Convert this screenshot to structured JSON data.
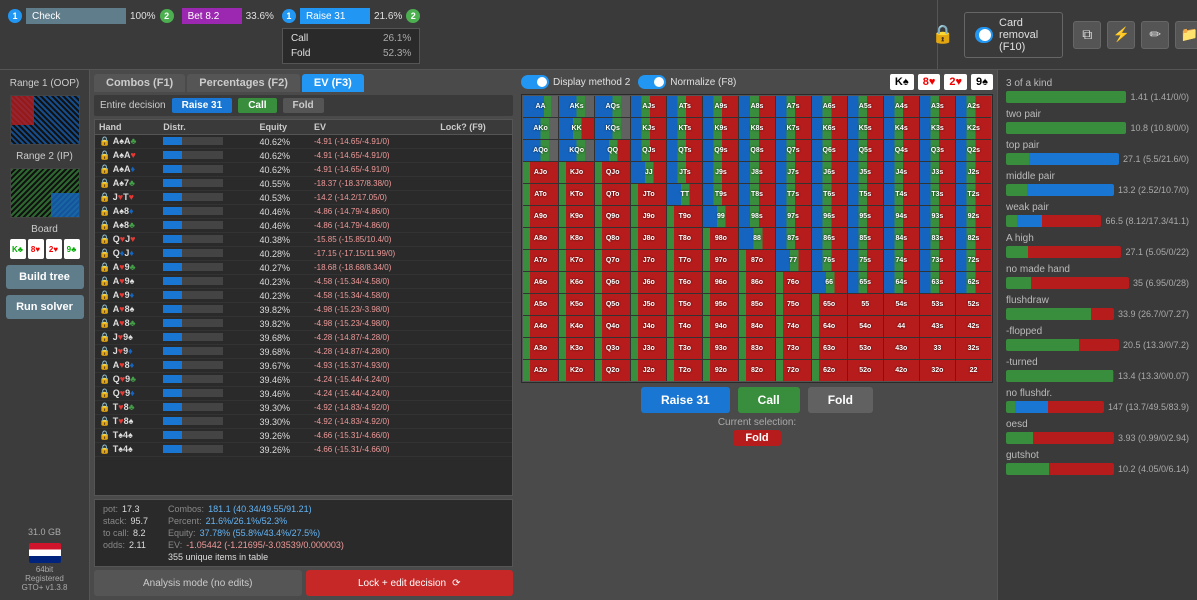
{
  "header": {
    "actions": [
      {
        "label": "Check",
        "pct": "100%",
        "type": "check",
        "badge": "1"
      },
      {
        "label": "Bet 8.2",
        "pct": "33.6%",
        "type": "bet",
        "badge": "2"
      },
      {
        "label": "Raise 31",
        "pct": "21.6%",
        "type": "raise",
        "badge": "1"
      },
      {
        "label": "Call",
        "pct": "26.1%",
        "type": "call"
      },
      {
        "label": "Fold",
        "pct": "52.3%",
        "type": "fold"
      }
    ],
    "card_removal": "Card removal (F10)",
    "badge2": "2"
  },
  "sidebar": {
    "range1_label": "Range 1 (OOP)",
    "range2_label": "Range 2 (IP)",
    "board_label": "Board",
    "board_cards": [
      "K♣",
      "8♥",
      "2♥",
      "9♣"
    ],
    "build_tree": "Build tree",
    "run_solver": "Run solver",
    "memory": "31.0 GB",
    "version": "64bit\nRegistered\nGTO+ v1.3.8"
  },
  "center": {
    "tabs": [
      "Combos (F1)",
      "Percentages (F2)",
      "EV (F3)"
    ],
    "active_tab": "EV (F3)",
    "toolbar": {
      "entire_decision": "Entire decision",
      "raise_label": "Raise 31",
      "call_label": "Call",
      "fold_label": "Fold"
    },
    "table_headers": [
      "Hand",
      "Distr.",
      "Equity",
      "EV",
      "Lock? (F9)"
    ],
    "hands": [
      {
        "hand": "A♠A♣",
        "distr": "",
        "equity": "40.62%",
        "ev": "-4.91 (-14.65/-4.91/0)"
      },
      {
        "hand": "A♠A♥",
        "distr": "",
        "equity": "40.62%",
        "ev": "-4.91 (-14.65/-4.91/0)"
      },
      {
        "hand": "A♠A♦",
        "distr": "",
        "equity": "40.62%",
        "ev": "-4.91 (-14.65/-4.91/0)"
      },
      {
        "hand": "A♠7♣",
        "distr": "",
        "equity": "40.55%",
        "ev": "-18.37 (-18.37/8.38/0)"
      },
      {
        "hand": "J♥T♥",
        "distr": "",
        "equity": "40.53%",
        "ev": "-14.2 (-14.2/17.05/0)"
      },
      {
        "hand": "A♠8♦",
        "distr": "",
        "equity": "40.46%",
        "ev": "-4.86 (-14.79/-4.86/0)"
      },
      {
        "hand": "A♠8♣",
        "distr": "",
        "equity": "40.46%",
        "ev": "-4.86 (-14.79/-4.86/0)"
      },
      {
        "hand": "Q♥J♥",
        "distr": "",
        "equity": "40.38%",
        "ev": "-15.85 (-15.85/10.4/0)"
      },
      {
        "hand": "Q♦J♦",
        "distr": "",
        "equity": "40.28%",
        "ev": "-17.15 (-17.15/11.99/0)"
      },
      {
        "hand": "A♥9♣",
        "distr": "",
        "equity": "40.27%",
        "ev": "-18.68 (-18.68/8.34/0)"
      },
      {
        "hand": "A♥9♠",
        "distr": "",
        "equity": "40.23%",
        "ev": "-4.58 (-15.34/-4.58/0)"
      },
      {
        "hand": "A♥9♦",
        "distr": "",
        "equity": "40.23%",
        "ev": "-4.58 (-15.34/-4.58/0)"
      },
      {
        "hand": "A♥8♠",
        "distr": "",
        "equity": "39.82%",
        "ev": "-4.98 (-15.23/-3.98/0)"
      },
      {
        "hand": "A♥8♣",
        "distr": "",
        "equity": "39.82%",
        "ev": "-4.98 (-15.23/-4.98/0)"
      },
      {
        "hand": "J♥9♠",
        "distr": "",
        "equity": "39.68%",
        "ev": "-4.28 (-14.87/-4.28/0)"
      },
      {
        "hand": "J♥9♦",
        "distr": "",
        "equity": "39.68%",
        "ev": "-4.28 (-14.87/-4.28/0)"
      },
      {
        "hand": "A♥8♦",
        "distr": "",
        "equity": "39.67%",
        "ev": "-4.93 (-15.37/-4.93/0)"
      },
      {
        "hand": "Q♥9♣",
        "distr": "",
        "equity": "39.46%",
        "ev": "-4.24 (-15.44/-4.24/0)"
      },
      {
        "hand": "Q♥9♦",
        "distr": "",
        "equity": "39.46%",
        "ev": "-4.24 (-15.44/-4.24/0)"
      },
      {
        "hand": "T♥8♣",
        "distr": "",
        "equity": "39.30%",
        "ev": "-4.92 (-14.83/-4.92/0)"
      },
      {
        "hand": "T♥8♠",
        "distr": "",
        "equity": "39.30%",
        "ev": "-4.92 (-14.83/-4.92/0)"
      },
      {
        "hand": "T♠4♠",
        "distr": "",
        "equity": "39.26%",
        "ev": "-4.66 (-15.31/-4.66/0)"
      },
      {
        "hand": "T♠4♠",
        "distr": "",
        "equity": "39.26%",
        "ev": "-4.66 (-15.31/-4.66/0)"
      }
    ],
    "bottom_stats": {
      "pot": "17.3",
      "stack": "95.7",
      "to_call": "8.2",
      "odds": "2.11",
      "combos": "181.1 (40.34/49.55/91.21)",
      "percent": "21.6%/26.1%/52.3%",
      "equity": "37.78% (55.8%/43.4%/27.5%)",
      "ev": "-1.05442 (-1.21695/-3.03539/0.000003)",
      "unique": "355 unique items in table"
    },
    "analysis_btn": "Analysis mode (no edits)",
    "lock_btn": "Lock + edit decision"
  },
  "matrix": {
    "display_method": "Display method 2",
    "normalize": "Normalize (F8)",
    "columns": [
      "AA",
      "AKs",
      "AQs",
      "AJs",
      "ATs",
      "A9s",
      "A8s",
      "A7s",
      "A6s",
      "A5s",
      "A4s",
      "A3s",
      "A2s"
    ],
    "rows": [
      [
        "AA",
        "AKs",
        "AQs",
        "AJs",
        "ATs",
        "A9s",
        "A8s",
        "A7s",
        "A6s",
        "A5s",
        "A4s",
        "A3s",
        "A2s"
      ],
      [
        "AKo",
        "KK",
        "KQs",
        "KJs",
        "KTs",
        "K9s",
        "K8s",
        "K7s",
        "K6s",
        "K5s",
        "K4s",
        "K3s",
        "K2s"
      ],
      [
        "AQo",
        "KQo",
        "QQ",
        "QJs",
        "QTs",
        "Q9s",
        "Q8s",
        "Q7s",
        "Q6s",
        "Q5s",
        "Q4s",
        "Q3s",
        "Q2s"
      ],
      [
        "AJo",
        "KJo",
        "QJo",
        "JJ",
        "JTs",
        "J9s",
        "J8s",
        "J7s",
        "J6s",
        "J5s",
        "J4s",
        "J3s",
        "J2s"
      ],
      [
        "ATo",
        "KTo",
        "QTo",
        "JTo",
        "TT",
        "T9s",
        "T8s",
        "T7s",
        "T6s",
        "T5s",
        "T4s",
        "T3s",
        "T2s"
      ],
      [
        "A9o",
        "K9o",
        "Q9o",
        "J9o",
        "T9o",
        "99",
        "98s",
        "97s",
        "96s",
        "95s",
        "94s",
        "93s",
        "92s"
      ],
      [
        "A8o",
        "K8o",
        "Q8o",
        "J8o",
        "T8o",
        "98o",
        "88",
        "87s",
        "86s",
        "85s",
        "84s",
        "83s",
        "82s"
      ],
      [
        "A7o",
        "K7o",
        "Q7o",
        "J7o",
        "T7o",
        "97o",
        "87o",
        "77",
        "76s",
        "75s",
        "74s",
        "73s",
        "72s"
      ],
      [
        "A6o",
        "K6o",
        "Q6o",
        "J6o",
        "T6o",
        "96o",
        "86o",
        "76o",
        "66",
        "65s",
        "64s",
        "63s",
        "62s"
      ],
      [
        "A5o",
        "K5o",
        "Q5o",
        "J5o",
        "T5o",
        "95o",
        "85o",
        "75o",
        "65o",
        "55",
        "54s",
        "53s",
        "52s"
      ],
      [
        "A4o",
        "K4o",
        "Q4o",
        "J4o",
        "T4o",
        "94o",
        "84o",
        "74o",
        "64o",
        "54o",
        "44",
        "43s",
        "42s"
      ],
      [
        "A3o",
        "K3o",
        "Q3o",
        "J3o",
        "T3o",
        "93o",
        "83o",
        "73o",
        "63o",
        "53o",
        "43o",
        "33",
        "32s"
      ],
      [
        "A2o",
        "K2o",
        "Q2o",
        "J2o",
        "T2o",
        "92o",
        "82o",
        "72o",
        "62o",
        "52o",
        "42o",
        "32o",
        "22"
      ]
    ],
    "action_buttons": [
      {
        "label": "Raise 31",
        "type": "raise"
      },
      {
        "label": "Call",
        "type": "call"
      },
      {
        "label": "Fold",
        "type": "fold"
      }
    ],
    "current_selection_label": "Current selection:",
    "current_selection_value": "Fold"
  },
  "stats_panel": {
    "items": [
      {
        "name": "3 of a kind",
        "value": "1.41 (1.41/0/0)",
        "segs": [
          {
            "type": "green",
            "pct": 100
          }
        ]
      },
      {
        "name": "two pair",
        "value": "10.8 (10.8/0/0)",
        "segs": [
          {
            "type": "green",
            "pct": 100
          }
        ]
      },
      {
        "name": "top pair",
        "value": "27.1 (5.5/21.6/0)",
        "segs": [
          {
            "type": "green",
            "pct": 20
          },
          {
            "type": "blue",
            "pct": 80
          }
        ]
      },
      {
        "name": "middle pair",
        "value": "13.2 (2.52/10.7/0)",
        "segs": [
          {
            "type": "green",
            "pct": 19
          },
          {
            "type": "blue",
            "pct": 81
          }
        ]
      },
      {
        "name": "weak pair",
        "value": "66.5 (8.12/17.3/41.1)",
        "segs": [
          {
            "type": "green",
            "pct": 12
          },
          {
            "type": "blue",
            "pct": 26
          },
          {
            "type": "red",
            "pct": 62
          }
        ]
      },
      {
        "name": "A high",
        "value": "27.1 (5.05/0/22)",
        "segs": [
          {
            "type": "green",
            "pct": 19
          },
          {
            "type": "red",
            "pct": 81
          }
        ]
      },
      {
        "name": "no made hand",
        "value": "35 (6.95/0/28)",
        "segs": [
          {
            "type": "green",
            "pct": 20
          },
          {
            "type": "red",
            "pct": 80
          }
        ]
      },
      {
        "name": "flushdraw",
        "value": "33.9 (26.7/0/7.27)",
        "segs": [
          {
            "type": "green",
            "pct": 79
          },
          {
            "type": "red",
            "pct": 21
          }
        ]
      },
      {
        "name": "-flopped",
        "value": "20.5 (13.3/0/7.2)",
        "segs": [
          {
            "type": "green",
            "pct": 65
          },
          {
            "type": "red",
            "pct": 35
          }
        ]
      },
      {
        "name": "-turned",
        "value": "13.4 (13.3/0/0.07)",
        "segs": [
          {
            "type": "green",
            "pct": 99
          },
          {
            "type": "red",
            "pct": 1
          }
        ]
      },
      {
        "name": "no flushdr.",
        "value": "147 (13.7/49.5/83.9)",
        "segs": [
          {
            "type": "green",
            "pct": 9
          },
          {
            "type": "blue",
            "pct": 34
          },
          {
            "type": "red",
            "pct": 57
          }
        ]
      },
      {
        "name": "oesd",
        "value": "3.93 (0.99/0/2.94)",
        "segs": [
          {
            "type": "green",
            "pct": 25
          },
          {
            "type": "red",
            "pct": 75
          }
        ]
      },
      {
        "name": "gutshot",
        "value": "10.2 (4.05/0/6.14)",
        "segs": [
          {
            "type": "green",
            "pct": 40
          },
          {
            "type": "red",
            "pct": 60
          }
        ]
      }
    ]
  }
}
